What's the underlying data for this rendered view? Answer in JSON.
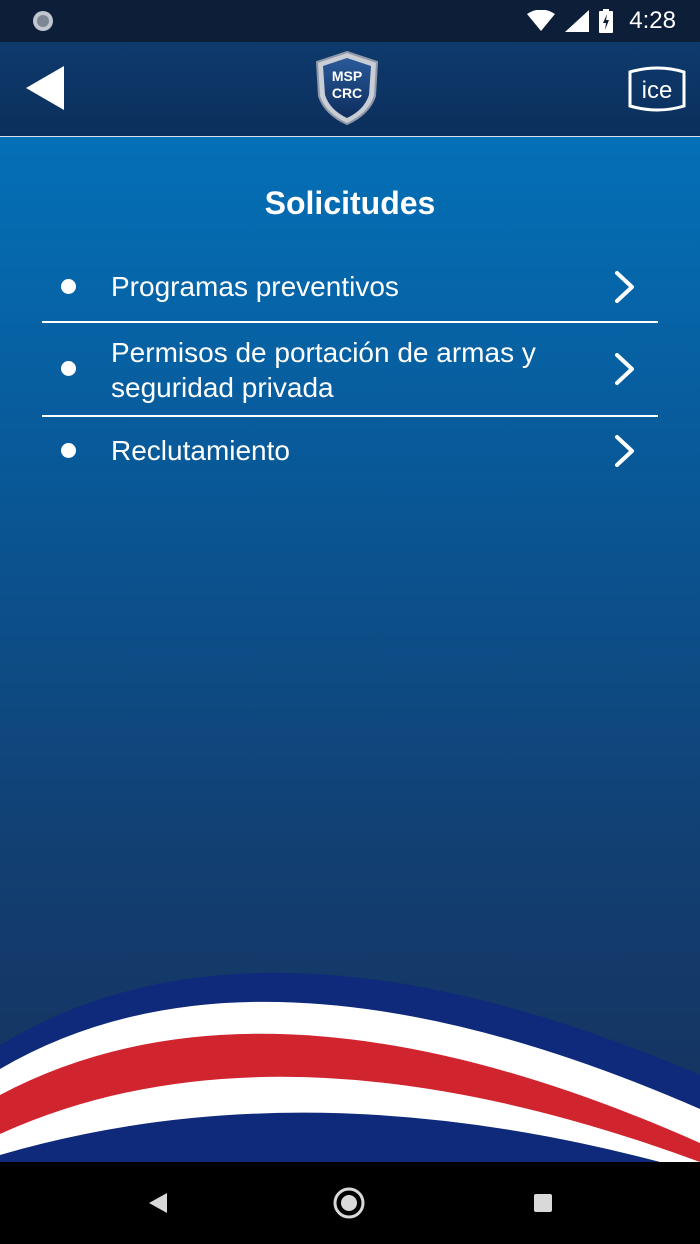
{
  "status_bar": {
    "time": "4:28",
    "icons": [
      "notification-icon",
      "wifi-icon",
      "signal-icon",
      "battery-icon"
    ]
  },
  "header": {
    "back_icon": "back-arrow-icon",
    "logo_text_top": "MSP",
    "logo_text_bottom": "CRC",
    "partner_logo_text": "ice"
  },
  "main": {
    "title": "Solicitudes",
    "items": [
      {
        "label": "Programas preventivos"
      },
      {
        "label": "Permisos de portación de armas y seguridad privada"
      },
      {
        "label": "Reclutamiento"
      }
    ]
  },
  "nav_bar": {
    "icons": [
      "nav-back-icon",
      "nav-home-icon",
      "nav-recents-icon"
    ]
  },
  "colors": {
    "header_bg": "#0e3a6d",
    "content_top": "#0470b7",
    "content_bottom": "#16315c",
    "flag_blue": "#0f2a7a",
    "flag_red": "#d0242f",
    "flag_white": "#ffffff"
  }
}
